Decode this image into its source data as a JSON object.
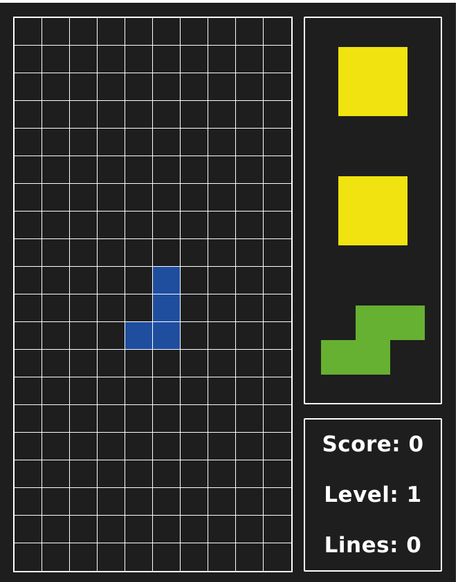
{
  "theme": {
    "background": "#1e1e1e",
    "grid_line": "#ffffff"
  },
  "board": {
    "columns": 10,
    "rows": 20,
    "active_piece": {
      "shape": "J",
      "color": "#1f4e9e",
      "cells": [
        {
          "row": 9,
          "col": 5
        },
        {
          "row": 10,
          "col": 5
        },
        {
          "row": 11,
          "col": 4
        },
        {
          "row": 11,
          "col": 5
        }
      ]
    }
  },
  "next_pieces": [
    {
      "shape": "O",
      "color": "#f0e30f"
    },
    {
      "shape": "O",
      "color": "#f0e30f"
    },
    {
      "shape": "S",
      "color": "#66b032"
    }
  ],
  "stats": {
    "score_text": "Score: 0",
    "level_text": "Level: 1",
    "lines_text": "Lines: 0",
    "score": 0,
    "level": 1,
    "lines": 0
  }
}
